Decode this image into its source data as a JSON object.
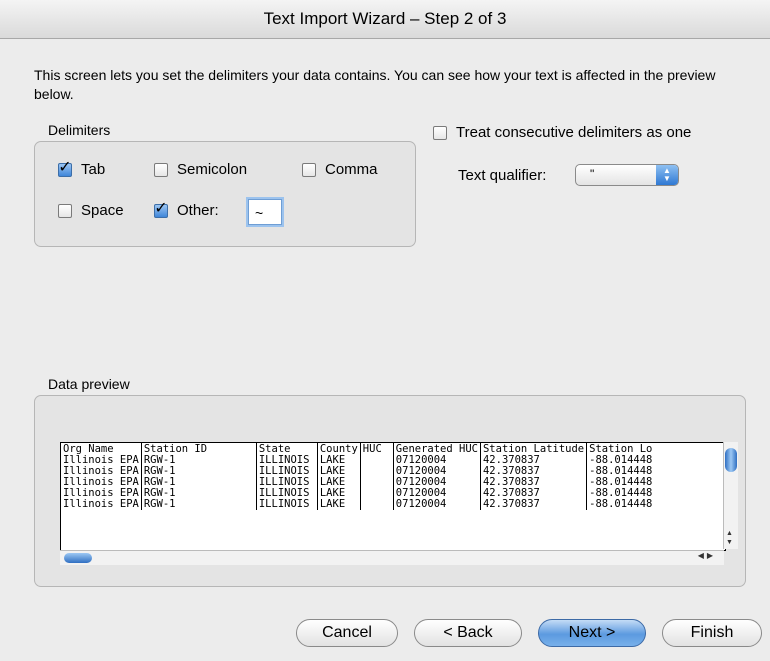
{
  "window": {
    "title": "Text Import Wizard – Step 2 of 3"
  },
  "intro_text": "This screen lets you set the delimiters your data contains.  You can see how your text is affected in the preview below.",
  "delimiters": {
    "group_label": "Delimiters",
    "tab": {
      "label": "Tab",
      "checked": true
    },
    "semicolon": {
      "label": "Semicolon",
      "checked": false
    },
    "comma": {
      "label": "Comma",
      "checked": false
    },
    "space": {
      "label": "Space",
      "checked": false
    },
    "other": {
      "label": "Other:",
      "checked": true,
      "value": "~"
    }
  },
  "consecutive": {
    "label": "Treat consecutive delimiters as one",
    "checked": false
  },
  "text_qualifier": {
    "label": "Text qualifier:",
    "value": "\""
  },
  "preview": {
    "group_label": "Data preview",
    "columns": [
      "Org Name",
      "Station ID",
      "State",
      "County",
      "HUC",
      "Generated HUC",
      "Station Latitude",
      "Station Lo"
    ],
    "rows": [
      [
        "Illinois EPA",
        "RGW-1",
        "ILLINOIS",
        "LAKE",
        "",
        "07120004",
        "42.370837",
        "-88.014448"
      ],
      [
        "Illinois EPA",
        "RGW-1",
        "ILLINOIS",
        "LAKE",
        "",
        "07120004",
        "42.370837",
        "-88.014448"
      ],
      [
        "Illinois EPA",
        "RGW-1",
        "ILLINOIS",
        "LAKE",
        "",
        "07120004",
        "42.370837",
        "-88.014448"
      ],
      [
        "Illinois EPA",
        "RGW-1",
        "ILLINOIS",
        "LAKE",
        "",
        "07120004",
        "42.370837",
        "-88.014448"
      ],
      [
        "Illinois EPA",
        "RGW-1",
        "ILLINOIS",
        "LAKE",
        "",
        "07120004",
        "42.370837",
        "-88.014448"
      ]
    ]
  },
  "buttons": {
    "cancel": "Cancel",
    "back": "< Back",
    "next": "Next >",
    "finish": "Finish"
  },
  "colors": {
    "default_button": "#5c9ae0",
    "window_bg": "#ececec"
  }
}
